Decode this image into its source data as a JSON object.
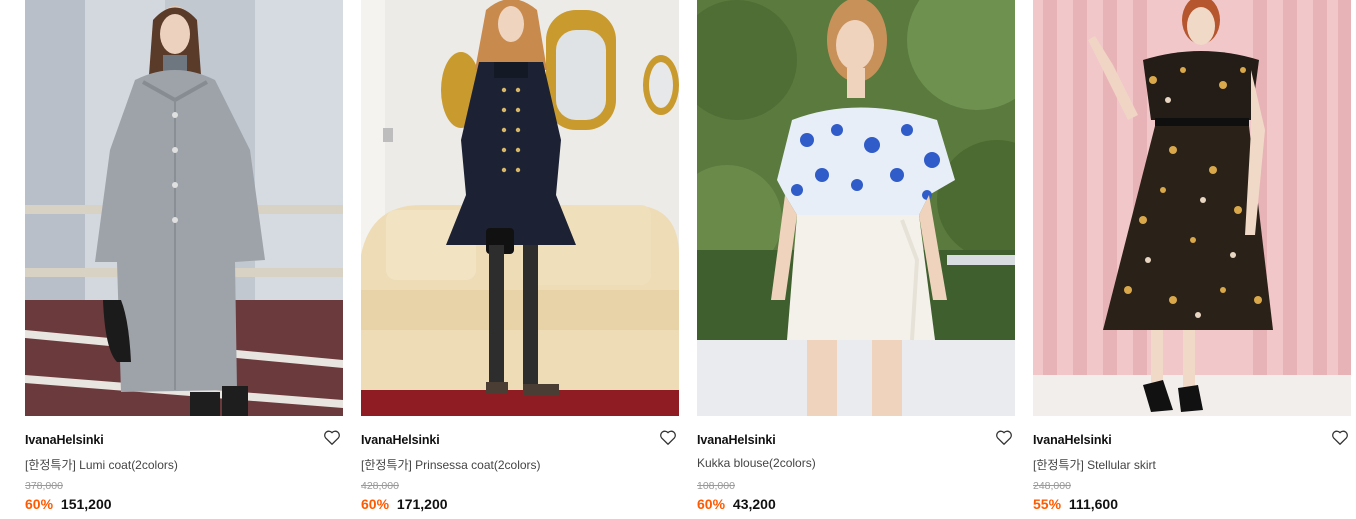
{
  "products": [
    {
      "brand": "IvanaHelsinki",
      "name": "[한정특가] Lumi coat(2colors)",
      "original_price": "378,000",
      "discount": "60%",
      "price": "151,200",
      "wishlist_icon": "heart-outline-icon",
      "image_alt": "Model wearing a long grey wool coat"
    },
    {
      "brand": "IvanaHelsinki",
      "name": "[한정특가] Prinsessa coat(2colors)",
      "original_price": "428,000",
      "discount": "60%",
      "price": "171,200",
      "wishlist_icon": "heart-outline-icon",
      "image_alt": "Model wearing a navy short coat with gold buttons"
    },
    {
      "brand": "IvanaHelsinki",
      "name": "Kukka blouse(2colors)",
      "original_price": "108,000",
      "discount": "60%",
      "price": "43,200",
      "wishlist_icon": "heart-outline-icon",
      "image_alt": "Model wearing a blue floral blouse and white skirt"
    },
    {
      "brand": "IvanaHelsinki",
      "name": "[한정특가] Stellular skirt",
      "original_price": "248,000",
      "discount": "55%",
      "price": "111,600",
      "wishlist_icon": "heart-outline-icon",
      "image_alt": "Model wearing a dark floral dress against pink wall"
    }
  ],
  "colors": {
    "discount": "#ff5a00",
    "brand_text": "#111111",
    "name_text": "#444444",
    "original_price": "#9a9a9a"
  }
}
